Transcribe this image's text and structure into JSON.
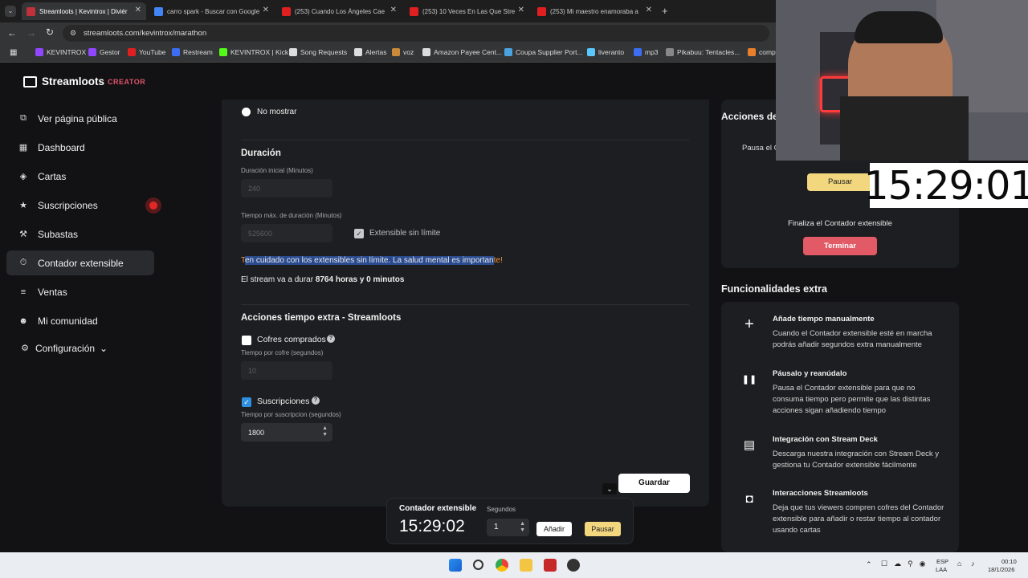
{
  "browser": {
    "tabs": [
      {
        "label": "Streamloots | Kevintrox | Diviér",
        "active": true,
        "fav": "#c1313b"
      },
      {
        "label": "carro spark - Buscar con Google",
        "active": false,
        "fav": "#4285f4"
      },
      {
        "label": "(253) Cuando Los Ángeles Cae",
        "active": false,
        "fav": "#e02020"
      },
      {
        "label": "(253) 10 Veces En Las Que Stre",
        "active": false,
        "fav": "#e02020"
      },
      {
        "label": "(253) Mi maestro enamoraba a",
        "active": false,
        "fav": "#e02020"
      }
    ],
    "new_tab": "+",
    "url": "streamloots.com/kevintrox/marathon",
    "bookmarks": [
      {
        "label": "KEVINTROX",
        "color": "#9146ff"
      },
      {
        "label": "Gestor",
        "color": "#9146ff"
      },
      {
        "label": "YouTube",
        "color": "#e02020"
      },
      {
        "label": "Restream",
        "color": "#3d6df2"
      },
      {
        "label": "KEVINTROX | Kick",
        "color": "#53fc18"
      },
      {
        "label": "Song Requests",
        "color": "#dddddd"
      },
      {
        "label": "Alertas",
        "color": "#dddddd"
      },
      {
        "label": "voz",
        "color": "#c98a3a"
      },
      {
        "label": "Amazon Payee Cent...",
        "color": "#dddddd"
      },
      {
        "label": "Coupa Supplier Port...",
        "color": "#4aa3df"
      },
      {
        "label": "liveranto",
        "color": "#5ac8fa"
      },
      {
        "label": "mp3",
        "color": "#3d6df2"
      },
      {
        "label": "Pikabuu: Tentacles...",
        "color": "#888888"
      },
      {
        "label": "comp",
        "color": "#e87f2a"
      }
    ]
  },
  "brand": {
    "name": "Streamloots",
    "suffix": "CREATOR"
  },
  "sidebar": {
    "items": [
      {
        "label": "Ver página pública",
        "icon": "public-page-icon"
      },
      {
        "label": "Dashboard",
        "icon": "dashboard-icon"
      },
      {
        "label": "Cartas",
        "icon": "cards-icon"
      },
      {
        "label": "Suscripciones",
        "icon": "star-icon"
      },
      {
        "label": "Subastas",
        "icon": "auction-icon"
      },
      {
        "label": "Contador extensible",
        "icon": "timer-icon",
        "active": true
      },
      {
        "label": "Ventas",
        "icon": "sales-icon"
      },
      {
        "label": "Mi comunidad",
        "icon": "community-icon"
      },
      {
        "label": "Configuración",
        "icon": "gear-icon"
      }
    ]
  },
  "form": {
    "no_mostrar": "No mostrar",
    "duracion_title": "Duración",
    "duracion_inicial_label": "Duración inicial (Minutos)",
    "duracion_inicial_value": "240",
    "tiempo_max_label": "Tiempo máx. de duración (Minutos)",
    "tiempo_max_value": "525600",
    "extensible_label": "Extensible sin límite",
    "warning_first": "T",
    "warning_selected": "en cuidado con los extensibles sin límite. La salud mental es importan",
    "warning_last": "te!",
    "duration_prefix": "El stream va a durar ",
    "duration_bold": "8764 horas y 0 minutos",
    "acciones_title": "Acciones tiempo extra - Streamloots",
    "cofres_label": "Cofres comprados",
    "cofres_sub": "Tiempo por cofre (segundos)",
    "cofres_value": "10",
    "suscripciones_label": "Suscripciones",
    "suscripciones_sub": "Tiempo por suscripcion (segundos)",
    "suscripciones_value": "1800",
    "save_label": "Guardar",
    "help": "?"
  },
  "acciones_card": {
    "title": "Acciones de",
    "pause_text": "Pausa el C",
    "pause_button": "Pausar",
    "finish_text": "Finaliza el Contador extensible",
    "finish_button": "Terminar"
  },
  "extras": {
    "title": "Funcionalidades extra",
    "items": [
      {
        "title": "Añade tiempo manualmente",
        "desc": "Cuando el Contador extensible esté en marcha podrás añadir segundos extra manualmente",
        "icon": "plus-icon"
      },
      {
        "title": "Páusalo y reanúdalo",
        "desc": "Pausa el Contador extensible para que no consuma tiempo pero permite que las distintas acciones sigan añadiendo tiempo",
        "icon": "pause-icon"
      },
      {
        "title": "Integración con Stream Deck",
        "desc": "Descarga nuestra integración con Stream Deck y gestiona tu Contador extensible fácilmente",
        "icon": "stream-deck-icon"
      },
      {
        "title": "Interacciones Streamloots",
        "desc": "Deja que tus viewers compren cofres del Contador extensible para añadir o restar tiempo al contador usando cartas",
        "icon": "streamloots-icon"
      }
    ]
  },
  "bottom_bar": {
    "title": "Contador extensible",
    "time": "15:29:02",
    "seconds_label": "Segundos",
    "seconds_value": "1",
    "add_button": "Añadir",
    "pause_button": "Pausar"
  },
  "overlay": {
    "timer": "15:29:01"
  },
  "taskbar": {
    "lang_top": "ESP",
    "lang_bottom": "LAA",
    "time": "00:10",
    "date": "18/1/2026"
  },
  "colors": {
    "accent_yellow": "#f2d77f",
    "danger_red": "#e15a66",
    "checkbox_blue": "#2f8fe0",
    "selection_blue": "#2b4b8f",
    "warning_orange": "#e8923a"
  }
}
